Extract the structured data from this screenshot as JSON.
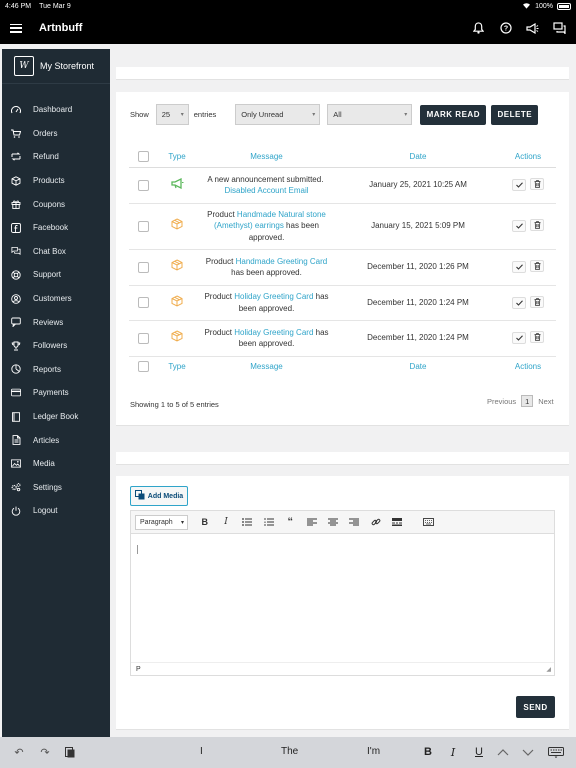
{
  "status_bar": {
    "time": "4:46 PM",
    "date": "Tue Mar 9",
    "battery": "100%"
  },
  "app_bar": {
    "title": "Artnbuff"
  },
  "sidebar": {
    "store_logo": "W",
    "store_name": "My Storefront",
    "items": [
      {
        "label": "Dashboard",
        "icon": "speedometer-icon"
      },
      {
        "label": "Orders",
        "icon": "cart-icon"
      },
      {
        "label": "Refund",
        "icon": "refund-icon"
      },
      {
        "label": "Products",
        "icon": "cube-icon"
      },
      {
        "label": "Coupons",
        "icon": "gift-icon"
      },
      {
        "label": "Facebook",
        "icon": "facebook-icon"
      },
      {
        "label": "Chat Box",
        "icon": "chat-icon"
      },
      {
        "label": "Support",
        "icon": "lifebuoy-icon"
      },
      {
        "label": "Customers",
        "icon": "user-circle-icon"
      },
      {
        "label": "Reviews",
        "icon": "comment-icon"
      },
      {
        "label": "Followers",
        "icon": "trophy-icon"
      },
      {
        "label": "Reports",
        "icon": "chart-icon"
      },
      {
        "label": "Payments",
        "icon": "credit-card-icon"
      },
      {
        "label": "Ledger Book",
        "icon": "book-icon"
      },
      {
        "label": "Articles",
        "icon": "document-icon"
      },
      {
        "label": "Media",
        "icon": "image-icon"
      },
      {
        "label": "Settings",
        "icon": "gears-icon"
      },
      {
        "label": "Logout",
        "icon": "power-icon"
      }
    ]
  },
  "controls": {
    "show_label": "Show",
    "entries_value": "25",
    "entries_label": "entries",
    "read_filter": "Only Unread",
    "type_filter": "All",
    "mark_read_label": "MARK READ",
    "delete_label": "DELETE"
  },
  "table": {
    "headers": {
      "type": "Type",
      "message": "Message",
      "date": "Date",
      "actions": "Actions"
    },
    "rows": [
      {
        "icon": "megaphone-icon",
        "pre": "A new announcement submitted.",
        "link": "Disabled Account Email",
        "post": "",
        "date": "January 25, 2021 10:25 AM"
      },
      {
        "icon": "box-icon",
        "pre": "Product",
        "link": "Handmade Natural stone (Amethyst) earrings",
        "post": "has been approved.",
        "date": "January 15, 2021 5:09 PM"
      },
      {
        "icon": "box-icon",
        "pre": "Product",
        "link": "Handmade Greeting Card",
        "post": "has been approved.",
        "date": "December 11, 2020 1:26 PM"
      },
      {
        "icon": "box-icon",
        "pre": "Product",
        "link": "Holiday Greeting Card",
        "post": "has been approved.",
        "date": "December 11, 2020 1:24 PM"
      },
      {
        "icon": "box-icon",
        "pre": "Product",
        "link": "Holiday Greeting Card",
        "post": "has been approved.",
        "date": "December 11, 2020 1:24 PM"
      }
    ],
    "info": "Showing 1 to 5 of 5 entries",
    "pager": {
      "previous": "Previous",
      "page": "1",
      "next": "Next"
    }
  },
  "editor": {
    "add_media_label": "Add Media",
    "format_value": "Paragraph",
    "path_label": "p",
    "send_label": "SEND"
  },
  "keyboard": {
    "suggestions": [
      "I",
      "The",
      "I'm"
    ],
    "bold": "B",
    "italic": "I",
    "underline": "U"
  },
  "colors": {
    "sidebar": "#1f2b34",
    "accent": "#2fa4c9",
    "button": "#23303a",
    "announce": "#5cb85c",
    "product": "#f0ad4e"
  }
}
